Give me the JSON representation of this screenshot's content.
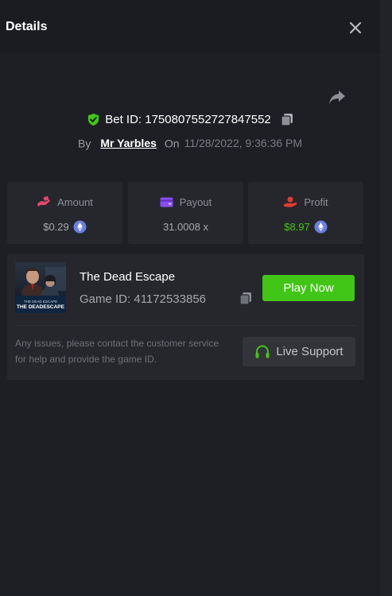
{
  "header": {
    "title": "Details"
  },
  "bet": {
    "id_label": "Bet ID: 1750807552727847552",
    "by_label": "By",
    "username": "Mr Yarbles",
    "on_label": "On",
    "date": "11/28/2022, 9:36:36 PM"
  },
  "stats": {
    "amount": {
      "label": "Amount",
      "value": "$0.29",
      "icon": "hand-coin-icon",
      "icon_color": "#e8466e"
    },
    "payout": {
      "label": "Payout",
      "value": "31.0008 x",
      "icon": "wallet-icon",
      "icon_color": "#8a4cf0"
    },
    "profit": {
      "label": "Profit",
      "value": "$8.97",
      "icon": "hand-money-icon",
      "icon_color": "#e33a2f",
      "value_color": "#41c516"
    }
  },
  "game": {
    "title": "The Dead Escape",
    "id_label": "Game ID: 41172533856",
    "thumb_caption": "THE DEADESCAPE",
    "play_label": "Play Now"
  },
  "support": {
    "text": "Any issues, please contact the customer service for help and provide the game ID.",
    "button_label": "Live Support"
  },
  "colors": {
    "accent_green": "#41c516",
    "panel_bg": "#1e1f24",
    "card_bg": "#26272c"
  }
}
